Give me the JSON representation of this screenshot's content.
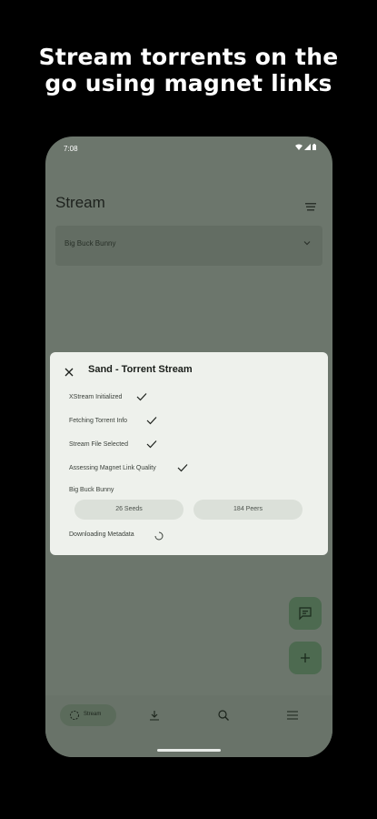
{
  "promo": {
    "headline_line1": "Stream torrents on the",
    "headline_line2": "go using magnet links"
  },
  "statusbar": {
    "time": "7:08"
  },
  "appbar": {
    "title": "Stream"
  },
  "dropdown": {
    "selected": "Big Buck Bunny"
  },
  "dialog": {
    "title": "Sand - Torrent Stream",
    "steps": [
      {
        "label": "XStream Initialized",
        "done": true
      },
      {
        "label": "Fetching Torrent Info",
        "done": true
      },
      {
        "label": "Stream File Selected",
        "done": true
      },
      {
        "label": "Assessing Magnet Link Quality",
        "done": true
      }
    ],
    "torrent_name": "Big Buck Bunny",
    "seeds": "26 Seeds",
    "peers": "184 Peers",
    "current_step": "Downloading Metadata"
  },
  "navbar": {
    "items": [
      {
        "label": "Stream",
        "icon": "stream-icon"
      },
      {
        "icon": "download-icon"
      },
      {
        "icon": "search-icon"
      },
      {
        "icon": "menu-icon"
      }
    ]
  },
  "colors": {
    "background": "#000000",
    "phone_scrim": "#6c766c",
    "dialog": "#eef1ec",
    "fab": "#4d6a50"
  }
}
